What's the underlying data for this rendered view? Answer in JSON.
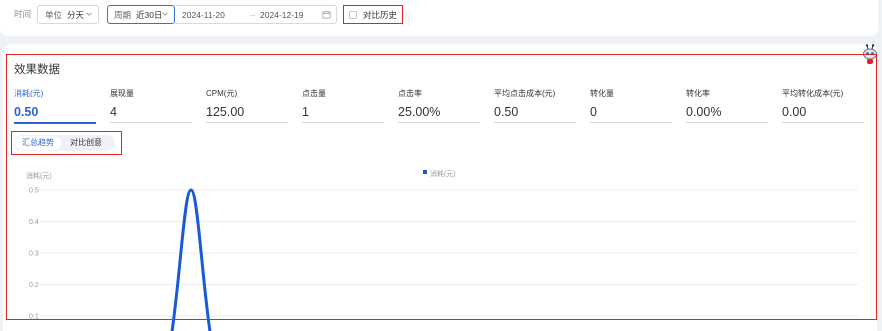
{
  "filter": {
    "time_label": "时间",
    "unit_label": "单位",
    "unit_value": "分天",
    "period_label": "周期",
    "period_value": "近30日",
    "date_start": "2024-11-20",
    "date_sep": "→",
    "date_end": "2024-12-19",
    "compare_history_label": "对比历史"
  },
  "section": {
    "title": "效果数据"
  },
  "metrics": [
    {
      "label": "消耗(元)",
      "value": "0.50"
    },
    {
      "label": "展现量",
      "value": "4"
    },
    {
      "label": "CPM(元)",
      "value": "125.00"
    },
    {
      "label": "点击量",
      "value": "1"
    },
    {
      "label": "点击率",
      "value": "25.00%"
    },
    {
      "label": "平均点击成本(元)",
      "value": "0.50"
    },
    {
      "label": "转化量",
      "value": "0"
    },
    {
      "label": "转化率",
      "value": "0.00%"
    },
    {
      "label": "平均转化成本(元)",
      "value": "0.00"
    }
  ],
  "tabs": [
    {
      "label": "汇总趋势"
    },
    {
      "label": "对比创意"
    }
  ],
  "icons": {
    "chevron": "chevron-down-icon",
    "calendar": "calendar-icon",
    "mascot": "robot-mascot-icon"
  },
  "colors": {
    "accent": "#2b64d6",
    "highlight_box": "#e0271f",
    "line": "#1a5ad8"
  },
  "chart_data": {
    "type": "line",
    "ylabel": "消耗(元)",
    "legend": [
      "消耗(元)"
    ],
    "legend_position": "top-center",
    "y_ticks": [
      "0.5",
      "0.4",
      "0.3",
      "0.2",
      "0.1"
    ],
    "ylim": [
      0,
      0.5
    ],
    "grid": true,
    "series": [
      {
        "name": "消耗(元)",
        "values": [
          0,
          0,
          0,
          0,
          0,
          0.5,
          0
        ]
      }
    ]
  }
}
